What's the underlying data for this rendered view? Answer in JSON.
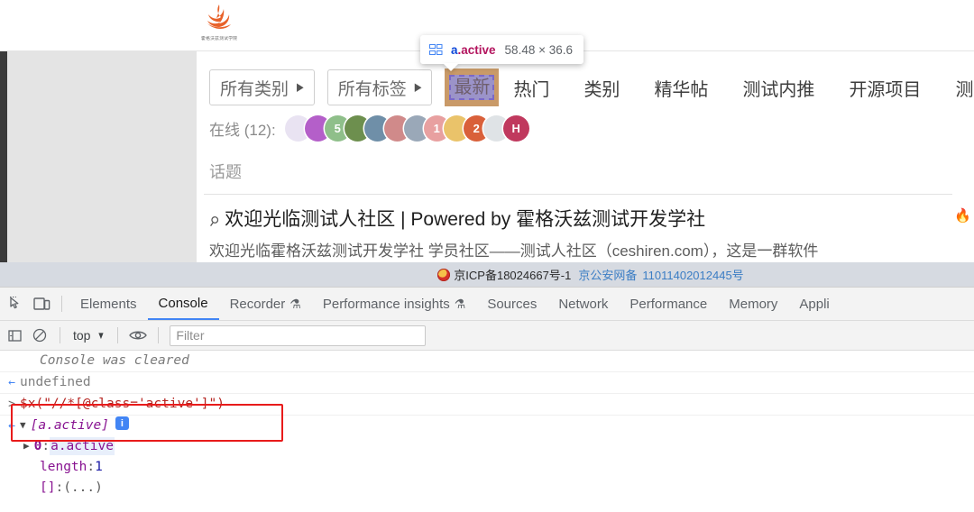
{
  "site": {
    "logo_text": "霍格沃兹测试学院",
    "logo_alt": "hogwarts-logo"
  },
  "nav": {
    "dropdowns": [
      {
        "label": "所有类别",
        "caret": "▶"
      },
      {
        "label": "所有标签",
        "caret": "▶"
      }
    ],
    "items": [
      {
        "label": "最新",
        "active": true
      },
      {
        "label": "热门",
        "active": false
      },
      {
        "label": "类别",
        "active": false
      },
      {
        "label": "精华帖",
        "active": false
      },
      {
        "label": "测试内推",
        "active": false
      },
      {
        "label": "开源项目",
        "active": false
      },
      {
        "label": "测试答疑",
        "active": false
      }
    ]
  },
  "online": {
    "label": "在线 (12):",
    "count": 12,
    "avatars": [
      {
        "name": "avatar-1",
        "color": "#e9e3f2",
        "initial": ""
      },
      {
        "name": "avatar-2",
        "color": "#b45fc9",
        "initial": ""
      },
      {
        "name": "avatar-3",
        "color": "#8fbf8a",
        "initial": "5"
      },
      {
        "name": "avatar-4",
        "color": "#6d8f4e",
        "initial": ""
      },
      {
        "name": "avatar-5",
        "color": "#6f8fa8",
        "initial": ""
      },
      {
        "name": "avatar-6",
        "color": "#d08a8a",
        "initial": ""
      },
      {
        "name": "avatar-7",
        "color": "#9aa8b8",
        "initial": ""
      },
      {
        "name": "avatar-8",
        "color": "#e8a0a0",
        "initial": "1"
      },
      {
        "name": "avatar-9",
        "color": "#eac36a",
        "initial": ""
      },
      {
        "name": "avatar-10",
        "color": "#d9603a",
        "initial": "2"
      },
      {
        "name": "avatar-11",
        "color": "#dfe3e6",
        "initial": ""
      },
      {
        "name": "avatar-12",
        "color": "#c0395e",
        "initial": "H"
      }
    ]
  },
  "topics": {
    "column_header": "话题",
    "list": [
      {
        "pin": "📌",
        "title": "欢迎光临测试人社区 | Powered by 霍格沃兹测试开发学社",
        "desc": "欢迎光临霍格沃兹测试开发学社 学员社区——测试人社区（ceshiren.com），这是一群软件"
      }
    ],
    "row_avatars": [
      {
        "name": "topic-avatar-1",
        "color": "#e7c23f"
      },
      {
        "name": "topic-avatar-2",
        "color": "#2e2e2e"
      },
      {
        "name": "topic-avatar-3",
        "color": "#9fc6e8"
      }
    ],
    "flame_icon": "🔥"
  },
  "inspector_tooltip": {
    "icon": "grid-layout-icon",
    "tag": "a",
    "class_name": ".active",
    "dimensions": "58.48 × 36.6"
  },
  "icp_footer": {
    "badge": "police-badge-icon",
    "icp_text": "京ICP备18024667号-1",
    "police_label": "京公安网备",
    "police_number": "11011402012445号"
  },
  "devtools": {
    "toolbar_icons": [
      {
        "name": "inspect-element-icon"
      },
      {
        "name": "device-toolbar-icon"
      }
    ],
    "tabs": [
      {
        "label": "Elements",
        "flask": "",
        "active": false
      },
      {
        "label": "Console",
        "flask": "",
        "active": true
      },
      {
        "label": "Recorder",
        "flask": "⚗",
        "active": false
      },
      {
        "label": "Performance insights",
        "flask": "⚗",
        "active": false
      },
      {
        "label": "Sources",
        "flask": "",
        "active": false
      },
      {
        "label": "Network",
        "flask": "",
        "active": false
      },
      {
        "label": "Performance",
        "flask": "",
        "active": false
      },
      {
        "label": "Memory",
        "flask": "",
        "active": false
      },
      {
        "label": "Appli",
        "flask": "",
        "active": false
      }
    ],
    "console_toolbar": {
      "sidebar_toggle": "console-sidebar-icon",
      "clear_icon": "clear-console-icon",
      "context": "top",
      "context_caret": "▼",
      "eye_icon": "live-expression-icon",
      "filter_placeholder": "Filter"
    },
    "console_lines": {
      "cleared_message": "Console was cleared",
      "undefined_result": "undefined",
      "command": "$x(\"//*[@class='active']\")",
      "command_fn": "$x",
      "command_arg": "(\"//*[@class='active']\")",
      "result_array": "[a.active]",
      "result_info_badge": "i",
      "expanded": [
        {
          "triangle": "▶",
          "key": "0",
          "sep": ": ",
          "value": "a.active",
          "kind": "node"
        },
        {
          "triangle": "",
          "key": "length",
          "sep": ": ",
          "value": "1",
          "kind": "number"
        },
        {
          "triangle": "",
          "key": "[[Prototype]]",
          "sep": ": ",
          "value": "(...)",
          "kind": "proto",
          "display_key": "[]"
        }
      ]
    },
    "prompt_symbol": ">",
    "return_symbol": "←"
  },
  "annotation": {
    "red_box": "highlight-command-rectangle",
    "color": "#e81b1b"
  }
}
